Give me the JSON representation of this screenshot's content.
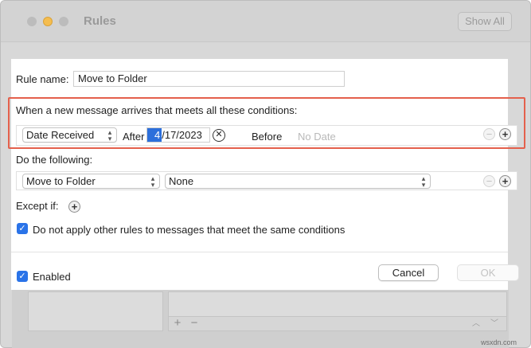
{
  "window": {
    "title": "Rules",
    "show_all_label": "Show All"
  },
  "rule": {
    "name_label": "Rule name:",
    "name_value": "Move to Folder"
  },
  "conditions": {
    "heading": "When a new message arrives that meets all these conditions:",
    "field": "Date Received",
    "after_label": "After",
    "after_date_selected": "4",
    "after_date_rest": "/17/2023",
    "clear_glyph": "✕",
    "before_label": "Before",
    "before_placeholder": "No Date"
  },
  "actions": {
    "heading": "Do the following:",
    "action": "Move to Folder",
    "target": "None"
  },
  "except": {
    "label": "Except if:"
  },
  "options": {
    "no_other_rules_label": "Do not apply other rules to messages that meet the same conditions",
    "no_other_rules_checked": true,
    "enabled_label": "Enabled",
    "enabled_checked": true
  },
  "buttons": {
    "cancel": "Cancel",
    "ok": "OK"
  },
  "background": {
    "add_glyph": "+",
    "remove_glyph": "−"
  },
  "watermark": "wsxdn.com",
  "colors": {
    "accent": "#2a73e8",
    "highlight_border": "#e4604c",
    "traffic_minimize": "#f5bd4f"
  }
}
